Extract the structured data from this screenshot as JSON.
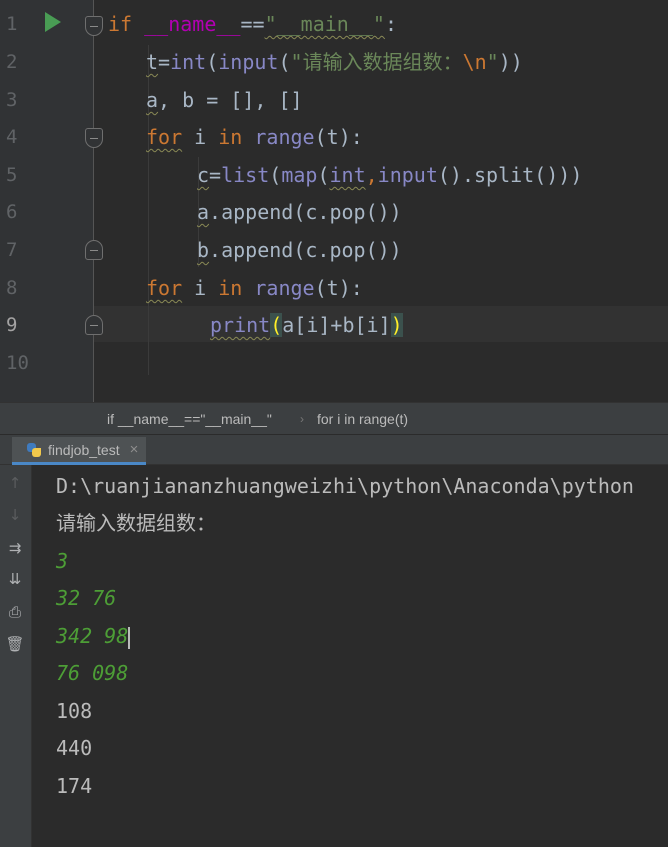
{
  "editor": {
    "line_numbers": [
      "1",
      "2",
      "3",
      "4",
      "5",
      "6",
      "7",
      "8",
      "9",
      "10"
    ],
    "lines": {
      "l1": {
        "kw_if": "if",
        "sp": " ",
        "name": "__name__",
        "eq": "==",
        "str": "\"__main__\"",
        "colon": ":"
      },
      "l2": {
        "t": "t",
        "eq": "=",
        "int": "int",
        "p1": "(",
        "input": "input",
        "p2": "(",
        "str_open": "\"请输入数据组数：",
        "esc": "\\n",
        "str_close": "\"",
        "p3": "))"
      },
      "l3": {
        "a": "a",
        "rest": ", b = [], []"
      },
      "l4": {
        "for": "for",
        "i": " i ",
        "in": "in",
        "sp": " ",
        "range": "range",
        "rest": "(t):"
      },
      "l5": {
        "c": "c",
        "eq": "=",
        "list": "list",
        "p1": "(",
        "map": "map",
        "p2": "(",
        "int": "int",
        "comma": ",",
        "input": "input",
        "rest": "().split()))"
      },
      "l6": {
        "a": "a",
        "rest": ".append(c.pop())"
      },
      "l7": {
        "b": "b",
        "rest": ".append(c.pop())"
      },
      "l8": {
        "for": "for",
        "i": " i ",
        "in": "in",
        "sp": " ",
        "range": "range",
        "rest": "(t):"
      },
      "l9": {
        "print": "print",
        "open": "(",
        "mid": "a[i]+b[i]",
        "close": ")"
      }
    }
  },
  "breadcrumb": {
    "item1": "if __name__==\"__main__\"",
    "sep": "›",
    "item2": "for i in range(t)"
  },
  "run_panel": {
    "tab_label": "findjob_test",
    "tab_close": "×",
    "console": {
      "path": "D:\\ruanjiananzhuangweizhi\\python\\Anaconda\\python",
      "prompt": "请输入数据组数：",
      "input_lines": [
        "3",
        "32 76",
        "342 98",
        "76 098"
      ],
      "output_lines": [
        "108",
        "440",
        "174"
      ]
    }
  },
  "icons": {
    "run": "run-gutter-icon",
    "up": "arrow-up-icon",
    "down": "arrow-down-icon",
    "wrap": "soft-wrap-icon",
    "scroll": "scroll-to-end-icon",
    "print": "print-icon",
    "trash": "trash-icon"
  }
}
